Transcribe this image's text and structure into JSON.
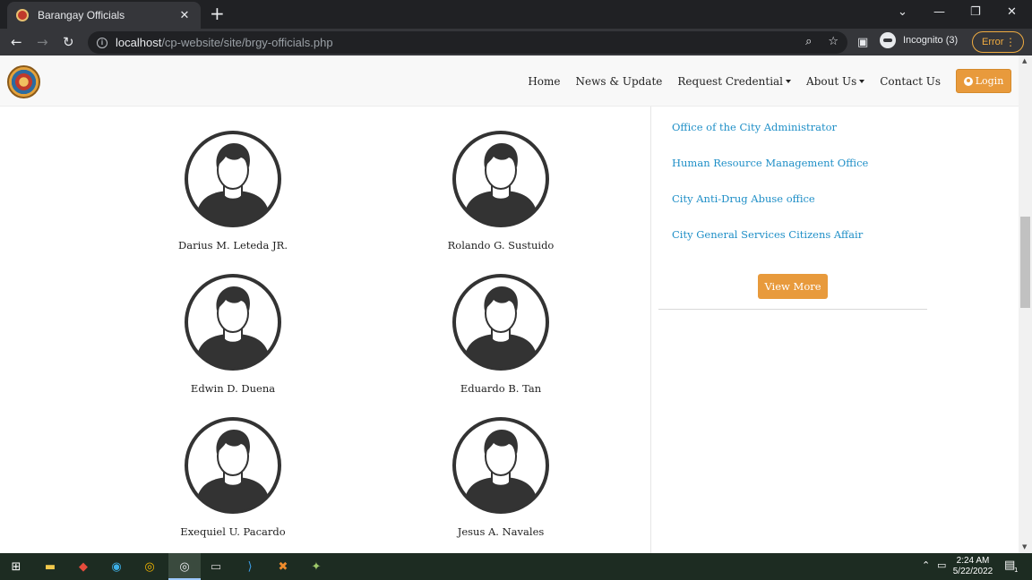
{
  "browser": {
    "tab_title": "Barangay Officials",
    "tab_close": "✕",
    "new_tab": "+",
    "url_host": "localhost",
    "url_path": "/cp-website/site/brgy-officials.php",
    "incognito_label": "Incognito (3)",
    "error_label": "Error",
    "menu_dots": "⋮",
    "window_controls": [
      "⌄",
      "—",
      "❐",
      "✕"
    ]
  },
  "site_nav": {
    "home": "Home",
    "news": "News & Update",
    "request": "Request Credential",
    "about": "About Us",
    "contact": "Contact Us",
    "login": "Login"
  },
  "officials": [
    {
      "name": "Darius M. Leteda JR."
    },
    {
      "name": "Rolando G. Sustuido"
    },
    {
      "name": "Edwin D. Duena"
    },
    {
      "name": "Eduardo B. Tan"
    },
    {
      "name": "Exequiel U. Pacardo"
    },
    {
      "name": "Jesus A. Navales"
    }
  ],
  "sidebar": {
    "links": [
      "Office of the City Administrator",
      "Human Resource Management Office",
      "City Anti-Drug Abuse office",
      "City General Services Citizens Affair"
    ],
    "view_more": "View More"
  },
  "taskbar": {
    "time": "2:24 AM",
    "date": "5/22/2022",
    "notification_count": "1"
  },
  "colors": {
    "accent_orange": "#e89a3c",
    "link_blue": "#1f8fc7",
    "chrome_dark": "#202124",
    "taskbar": "#1d2c22"
  }
}
